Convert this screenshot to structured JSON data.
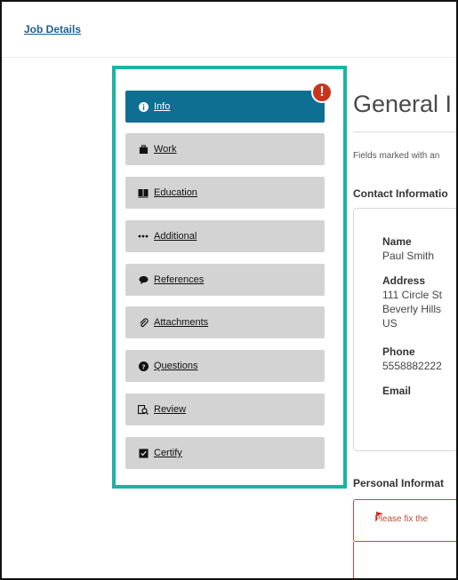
{
  "header": {
    "job_details_link": "Job Details"
  },
  "sidebar": {
    "alert_symbol": "!",
    "items": [
      {
        "label": "Info",
        "icon": "info-icon",
        "active": true
      },
      {
        "label": "Work",
        "icon": "briefcase-icon",
        "active": false
      },
      {
        "label": "Education",
        "icon": "book-icon",
        "active": false
      },
      {
        "label": "Additional",
        "icon": "more-icon",
        "active": false
      },
      {
        "label": "References",
        "icon": "speech-bubble-icon",
        "active": false
      },
      {
        "label": "Attachments",
        "icon": "paperclip-icon",
        "active": false
      },
      {
        "label": "Questions",
        "icon": "question-icon",
        "active": false
      },
      {
        "label": "Review",
        "icon": "review-icon",
        "active": false
      },
      {
        "label": "Certify",
        "icon": "certify-icon",
        "active": false
      }
    ]
  },
  "main": {
    "heading": "General I",
    "required_note": "Fields marked with an",
    "contact_title": "Contact Informatio",
    "contact": {
      "name_label": "Name",
      "name_value": "Paul Smith",
      "address_label": "Address",
      "address_line1": "111 Circle St",
      "address_line2": "Beverly Hills",
      "address_line3": "US",
      "phone_label": "Phone",
      "phone_value": "5558882222",
      "email_label": "Email"
    },
    "personal_title": "Personal Informat",
    "error_message": "Please fix the"
  },
  "colors": {
    "accent_teal": "#1ab3a5",
    "active_blue": "#0f6f93",
    "nav_gray": "#d3d3d3",
    "error_red": "#c24b3a",
    "alert_red": "#c8351f"
  }
}
